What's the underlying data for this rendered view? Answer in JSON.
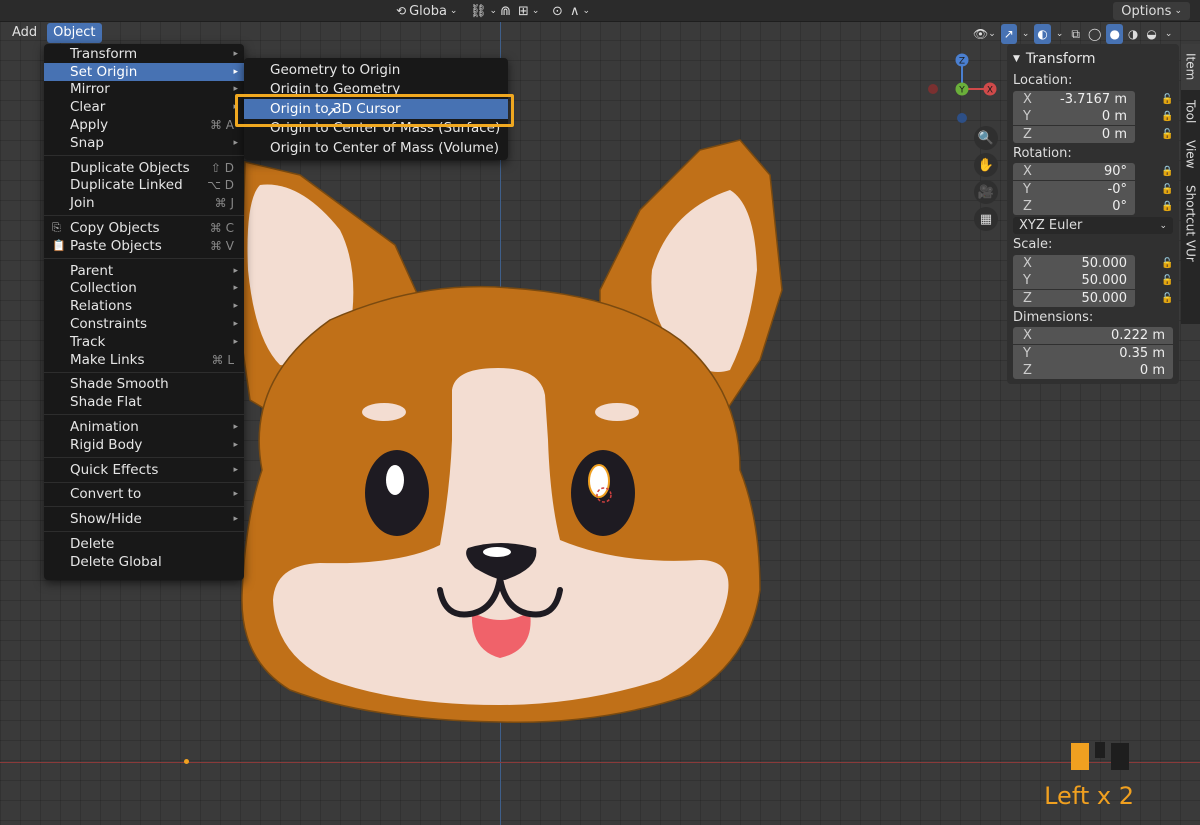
{
  "topbar": {
    "transform_orientation": "Globa",
    "options_label": "Options"
  },
  "menubar": {
    "items": [
      {
        "label": "Add"
      },
      {
        "label": "Object"
      }
    ]
  },
  "object_menu": {
    "items": [
      {
        "label": "Transform",
        "submenu": true
      },
      {
        "label": "Set Origin",
        "submenu": true
      },
      {
        "label": "Mirror",
        "submenu": true
      },
      {
        "label": "Clear",
        "submenu": true
      },
      {
        "label": "Apply",
        "shortcut": "⌘ A"
      },
      {
        "label": "Snap",
        "submenu": true
      },
      {
        "label": "Duplicate Objects",
        "shortcut": "⇧ D"
      },
      {
        "label": "Duplicate Linked",
        "shortcut": "⌥ D"
      },
      {
        "label": "Join",
        "shortcut": "⌘ J"
      },
      {
        "label": "Copy Objects",
        "shortcut": "⌘ C"
      },
      {
        "label": "Paste Objects",
        "shortcut": "⌘ V"
      },
      {
        "label": "Parent",
        "submenu": true
      },
      {
        "label": "Collection",
        "submenu": true
      },
      {
        "label": "Relations",
        "submenu": true
      },
      {
        "label": "Constraints",
        "submenu": true
      },
      {
        "label": "Track",
        "submenu": true
      },
      {
        "label": "Make Links",
        "shortcut": "⌘ L"
      },
      {
        "label": "Shade Smooth"
      },
      {
        "label": "Shade Flat"
      },
      {
        "label": "Animation",
        "submenu": true
      },
      {
        "label": "Rigid Body",
        "submenu": true
      },
      {
        "label": "Quick Effects",
        "submenu": true
      },
      {
        "label": "Convert to",
        "submenu": true
      },
      {
        "label": "Show/Hide",
        "submenu": true
      },
      {
        "label": "Delete"
      },
      {
        "label": "Delete Global"
      }
    ]
  },
  "set_origin_submenu": {
    "items": [
      {
        "label": "Geometry to Origin"
      },
      {
        "label": "Origin to Geometry"
      },
      {
        "label": "Origin to 3D Cursor"
      },
      {
        "label": "Origin to Center of Mass (Surface)"
      },
      {
        "label": "Origin to Center of Mass (Volume)"
      }
    ]
  },
  "gizmo": {
    "z": "Z",
    "y": "Y",
    "x": "X"
  },
  "npanel": {
    "title": "Transform",
    "location_label": "Location:",
    "location": [
      {
        "axis": "X",
        "value": "-3.7167 m"
      },
      {
        "axis": "Y",
        "value": "0 m"
      },
      {
        "axis": "Z",
        "value": "0 m"
      }
    ],
    "rotation_label": "Rotation:",
    "rotation": [
      {
        "axis": "X",
        "value": "90°"
      },
      {
        "axis": "Y",
        "value": "-0°"
      },
      {
        "axis": "Z",
        "value": "0°"
      }
    ],
    "rotation_mode": "XYZ Euler",
    "scale_label": "Scale:",
    "scale": [
      {
        "axis": "X",
        "value": "50.000"
      },
      {
        "axis": "Y",
        "value": "50.000"
      },
      {
        "axis": "Z",
        "value": "50.000"
      }
    ],
    "dimensions_label": "Dimensions:",
    "dimensions": [
      {
        "axis": "X",
        "value": "0.222 m"
      },
      {
        "axis": "Y",
        "value": "0.35 m"
      },
      {
        "axis": "Z",
        "value": "0 m"
      }
    ]
  },
  "side_tabs": [
    "Item",
    "Tool",
    "View",
    "Shortcut VUr"
  ],
  "operator_text": "Left x 2",
  "colors": {
    "accent": "#4772b3",
    "highlight_box": "#f0a820",
    "operator_text": "#f0a020",
    "corgi_fur": "#c07018",
    "corgi_cream": "#f3ddd2"
  }
}
